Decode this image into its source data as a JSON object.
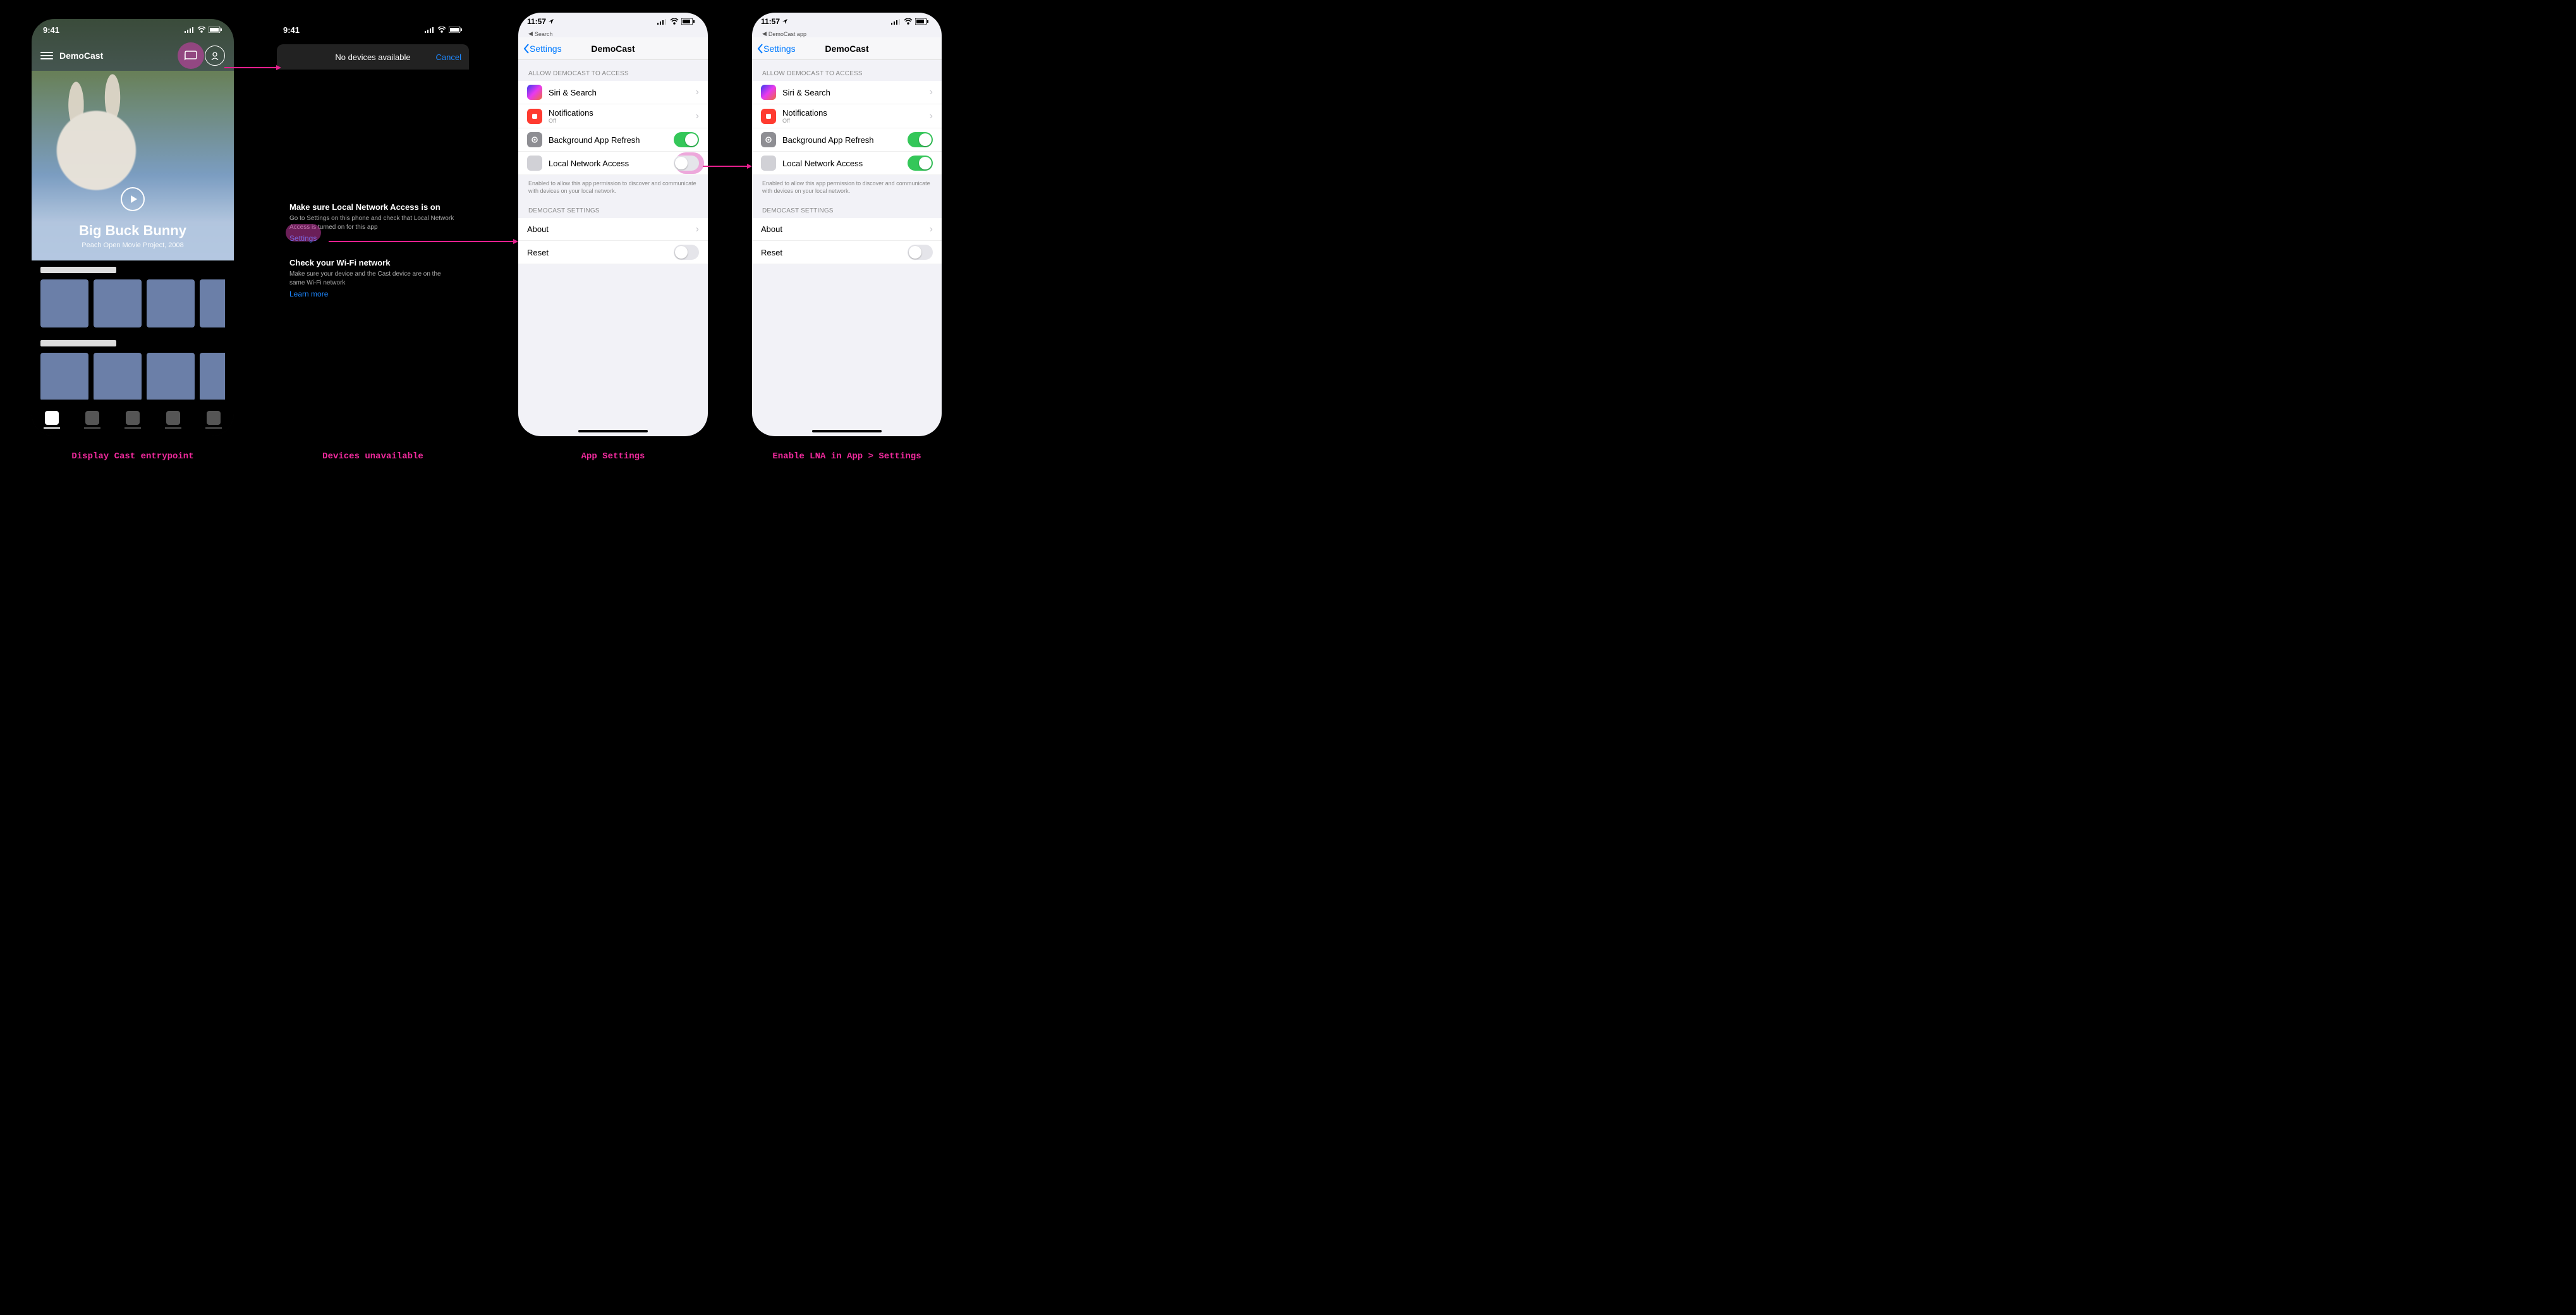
{
  "captions": {
    "c1": "Display Cast entrypoint",
    "c2": "Devices unavailable",
    "c3": "App Settings",
    "c4": "Enable LNA in App > Settings"
  },
  "screen1": {
    "time": "9:41",
    "app_name": "DemoCast",
    "hero_title": "Big Buck Bunny",
    "hero_subtitle": "Peach Open Movie Project, 2008"
  },
  "screen2": {
    "time": "9:41",
    "sheet_title": "No devices available",
    "cancel": "Cancel",
    "tip1_title": "Make sure Local Network Access is on",
    "tip1_body": "Go to Settings on this phone and check that Local Network Access is turned on for this app",
    "tip1_link": "Settings",
    "tip2_title": "Check your Wi-Fi network",
    "tip2_body": "Make sure your device and the Cast device are on the same Wi-Fi network",
    "tip2_link": "Learn more"
  },
  "ios": {
    "time": "11:57",
    "breadcrumb3": "Search",
    "breadcrumb4": "DemoCast app",
    "back_label": "Settings",
    "title": "DemoCast",
    "group1": "Allow DemoCast to Access",
    "siri": "Siri & Search",
    "notifications": "Notifications",
    "notifications_sub": "Off",
    "bg_refresh": "Background App Refresh",
    "lna": "Local Network Access",
    "lna_note": "Enabled to allow this app permission to discover and communicate with devices on your local network.",
    "group2": "DemoCast Settings",
    "about": "About",
    "reset": "Reset"
  }
}
